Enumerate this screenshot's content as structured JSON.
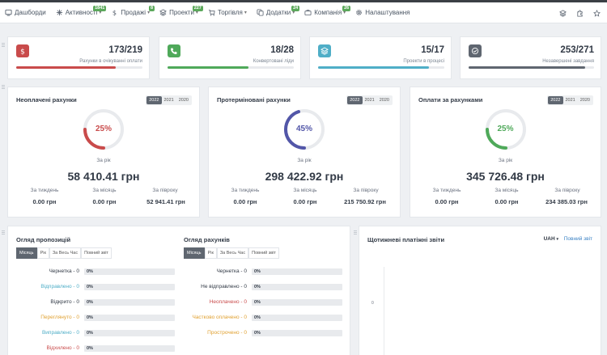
{
  "nav": {
    "items": [
      {
        "label": "Дашборди",
        "icon": "dashboard-icon",
        "badge": "",
        "caret": ""
      },
      {
        "label": "Активності",
        "icon": "activity-icon",
        "badge": "1841",
        "caret": "▾"
      },
      {
        "label": "Продажі",
        "icon": "dollar-icon",
        "badge": "8",
        "caret": "▾"
      },
      {
        "label": "Проекти",
        "icon": "layers-icon",
        "badge": "227",
        "caret": "▾"
      },
      {
        "label": "Торгівля",
        "icon": "cart-icon",
        "badge": "",
        "caret": "▾"
      },
      {
        "label": "Додатки",
        "icon": "copy-icon",
        "badge": "24",
        "caret": "▾"
      },
      {
        "label": "Компанія",
        "icon": "briefcase-icon",
        "badge": "26",
        "caret": "▾"
      },
      {
        "label": "Налаштування",
        "icon": "gear-icon",
        "badge": "",
        "caret": ""
      }
    ],
    "right_icons": [
      "layers-icon",
      "puzzle-icon",
      "star-icon"
    ]
  },
  "stats": [
    {
      "value": "173/219",
      "label": "Рахунки в очікуванні оплати",
      "progress": 0.79,
      "color": "#c94b4b",
      "icon": "dollar-icon"
    },
    {
      "value": "18/28",
      "label": "Конвертовані ліди",
      "progress": 0.64,
      "color": "#4fa95a",
      "icon": "phone-icon"
    },
    {
      "value": "15/17",
      "label": "Проекти в процесі",
      "progress": 0.88,
      "color": "#4faec7",
      "icon": "layers-icon"
    },
    {
      "value": "253/271",
      "label": "Незавершені завдання",
      "progress": 0.93,
      "color": "#5f6670",
      "icon": "check-icon"
    }
  ],
  "invoices": [
    {
      "title": "Неоплачені рахунки",
      "years": [
        "2022",
        "2021",
        "2020"
      ],
      "percent": "25%",
      "ring_value": 0.25,
      "ring_color": "#c94b4b",
      "year_label": "За рік",
      "amount": "58 410.41 грн",
      "week_label": "За тиждень",
      "week": "0.00 грн",
      "month_label": "За місяць",
      "month": "0.00 грн",
      "half_label": "За півроку",
      "half": "52 941.41 грн"
    },
    {
      "title": "Протерміновані рахунки",
      "years": [
        "2022",
        "2021",
        "2020"
      ],
      "percent": "45%",
      "ring_value": 0.45,
      "ring_color": "#5256a8",
      "year_label": "За рік",
      "amount": "298 422.92 грн",
      "week_label": "За тиждень",
      "week": "0.00 грн",
      "month_label": "За місяць",
      "month": "0.00 грн",
      "half_label": "За півроку",
      "half": "215 750.92 грн"
    },
    {
      "title": "Оплати за рахунками",
      "years": [
        "2022",
        "2021",
        "2020"
      ],
      "percent": "25%",
      "ring_value": 0.25,
      "ring_color": "#4fa95a",
      "year_label": "За рік",
      "amount": "345 726.48 грн",
      "week_label": "За тиждень",
      "week": "0.00 грн",
      "month_label": "За місяць",
      "month": "0.00 грн",
      "half_label": "За півроку",
      "half": "234 385.03 грн"
    }
  ],
  "overview": {
    "proposals": {
      "title": "Огляд пропозицій",
      "tabs": [
        "Місяць",
        "Рік",
        "За Весь Час",
        "Повний звіт"
      ],
      "rows": [
        {
          "label": "Чернетка - 0",
          "value": "0%",
          "color": "#323a46"
        },
        {
          "label": "Відправлено - 0",
          "value": "0%",
          "color": "#4faec7"
        },
        {
          "label": "Відкрито - 0",
          "value": "0%",
          "color": "#323a46"
        },
        {
          "label": "Переглянуто - 0",
          "value": "0%",
          "color": "#e0a030"
        },
        {
          "label": "Виправлено - 0",
          "value": "0%",
          "color": "#4faec7"
        },
        {
          "label": "Відхилено - 0",
          "value": "0%",
          "color": "#c94b4b"
        }
      ]
    },
    "invoices": {
      "title": "Огляд рахунків",
      "tabs": [
        "Місяць",
        "Рік",
        "За Весь Час",
        "Повний звіт"
      ],
      "rows": [
        {
          "label": "Чернетка - 0",
          "value": "0%",
          "color": "#323a46"
        },
        {
          "label": "Не відправлено - 0",
          "value": "0%",
          "color": "#323a46"
        },
        {
          "label": "Неоплачено - 0",
          "value": "0%",
          "color": "#c94b4b"
        },
        {
          "label": "Частково оплачено - 0",
          "value": "0%",
          "color": "#e0a030"
        },
        {
          "label": "Прострочено - 0",
          "value": "0%",
          "color": "#e0a030"
        }
      ]
    }
  },
  "weekly": {
    "title": "Щотижневі платіжні звіти",
    "currency": "UAH",
    "caret": "▾",
    "report_link": "Повний звіт",
    "y_tick": "0"
  }
}
